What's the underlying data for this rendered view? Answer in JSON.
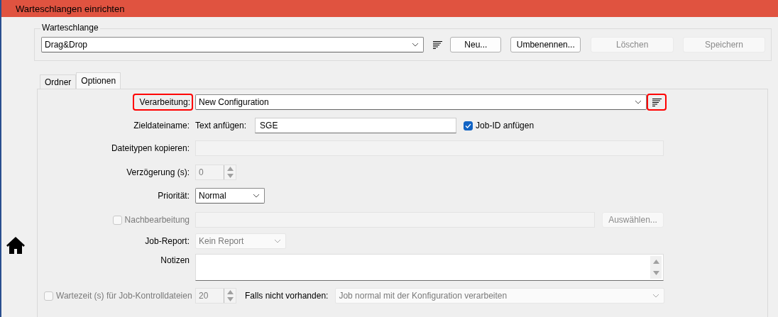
{
  "window": {
    "title": "Warteschlangen einrichten"
  },
  "queue_group": {
    "title": "Warteschlange",
    "queue": {
      "value": "Drag&Drop"
    },
    "buttons": [
      {
        "label": "Neu...",
        "disabled": false
      },
      {
        "label": "Umbenennen...",
        "disabled": false
      },
      {
        "label": "Löschen",
        "disabled": true
      },
      {
        "label": "Speichern",
        "disabled": true
      }
    ]
  },
  "tabs": [
    {
      "label": "Ordner",
      "selected": false
    },
    {
      "label": "Optionen",
      "selected": true
    }
  ],
  "options": {
    "processing": {
      "label": "Verarbeitung:",
      "value": "New Configuration",
      "highlighted": true,
      "menu_highlighted": true
    },
    "target_filename": {
      "label": "Zieldateiname:",
      "append_label": "Text anfügen:",
      "value": "SGE",
      "job_id": {
        "label": "Job-ID anfügen",
        "checked": true
      }
    },
    "copy_filetypes": {
      "label": "Dateitypen kopieren:",
      "disabled": true
    },
    "delay": {
      "label": "Verzögerung (s):",
      "value": "0",
      "disabled": true
    },
    "priority": {
      "label": "Priorität:",
      "value": "Normal"
    },
    "postprocessing": {
      "label": "Nachbearbeitung",
      "checked": false,
      "disabled": true,
      "button": "Auswählen..."
    },
    "job_report": {
      "label": "Job-Report:",
      "value": "Kein Report",
      "disabled": true
    },
    "notes": {
      "label": "Notizen"
    },
    "wait_time": {
      "label": "Wartezeit (s) für Job-Kontrolldateien",
      "checked": false,
      "disabled": true,
      "value": "20",
      "fallback_label": "Falls nicht vorhanden:",
      "fallback_value": "Job normal mit der Konfiguration verarbeiten"
    }
  }
}
